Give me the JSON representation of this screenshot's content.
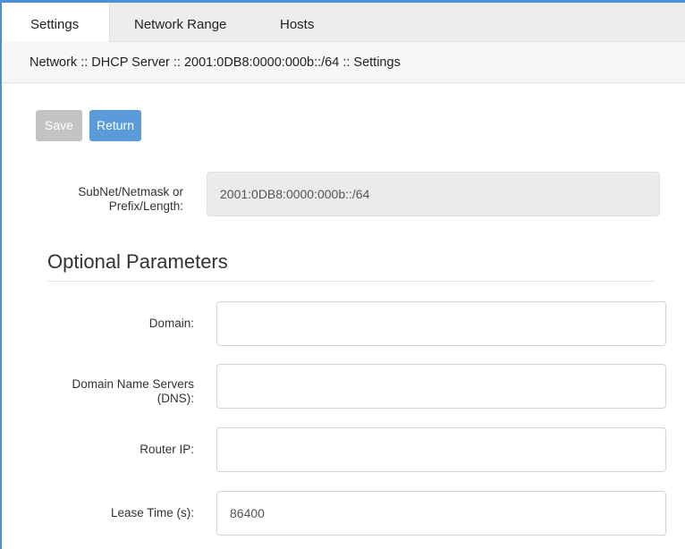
{
  "tabs": [
    {
      "label": "Settings",
      "active": true
    },
    {
      "label": "Network Range",
      "active": false
    },
    {
      "label": "Hosts",
      "active": false
    }
  ],
  "breadcrumb": "Network :: DHCP Server :: 2001:0DB8:0000:000b::/64 :: Settings",
  "buttons": {
    "save_label": "Save",
    "return_label": "Return"
  },
  "subnet": {
    "label_line1": "SubNet/Netmask or",
    "label_line2": "Prefix/Length:",
    "value": "2001:0DB8:0000:000b::/64"
  },
  "optional": {
    "title": "Optional Parameters",
    "domain_label": "Domain:",
    "domain_value": "",
    "dns_label_line1": "Domain Name Servers",
    "dns_label_line2": "(DNS):",
    "dns_value": "",
    "router_label": "Router IP:",
    "router_value": "",
    "lease_label": "Lease Time (s):",
    "lease_value": "86400"
  },
  "colors": {
    "accent": "#5b9bd9",
    "disabled": "#c3c3c3",
    "frame": "#4a90d9"
  }
}
